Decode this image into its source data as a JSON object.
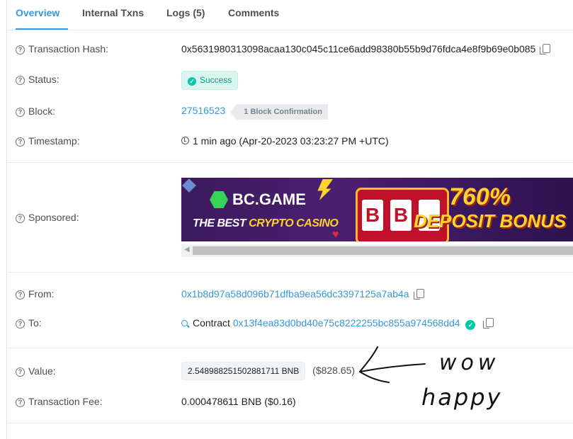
{
  "tabs": [
    {
      "label": "Overview"
    },
    {
      "label": "Internal Txns"
    },
    {
      "label": "Logs (5)"
    },
    {
      "label": "Comments"
    }
  ],
  "fields": {
    "hash": {
      "label": "Transaction Hash:",
      "value": "0x5631980313098acaa130c045c11ce6add98380b55b9d76fdca4e8f9b69e0b085"
    },
    "status": {
      "label": "Status:",
      "value": "Success"
    },
    "block": {
      "label": "Block:",
      "number": "27516523",
      "confirmations": "1 Block Confirmation"
    },
    "timestamp": {
      "label": "Timestamp:",
      "value": "1 min ago (Apr-20-2023 03:23:27 PM +UTC)"
    },
    "sponsored": {
      "label": "Sponsored:"
    },
    "from": {
      "label": "From:",
      "address": "0x1b8d97a58d096b71dfba9ea56dc3397125a7ab4a"
    },
    "to": {
      "label": "To:",
      "prefix": "Contract",
      "address": "0x13f4ea83d0bd40e75c8222255bc855a974568dd4"
    },
    "value": {
      "label": "Value:",
      "amount": "2.548988251502881711 BNB",
      "usd": "($828.65)"
    },
    "fee": {
      "label": "Transaction Fee:",
      "value": "0.000478611 BNB ($0.16)"
    }
  },
  "banner": {
    "brand": "BC.GAME",
    "tagline_1": "THE BEST ",
    "tagline_2": "CRYPTO CASINO",
    "percent": "760%",
    "bonus": "DEPOSIT BONUS",
    "slot_symbol": "B"
  },
  "annotation": {
    "line1": "wow",
    "line2": "happy"
  },
  "colors": {
    "accent": "#3498db",
    "success": "#00c9a7",
    "text": "#1e2022",
    "banner_yellow": "#ffd22d"
  }
}
